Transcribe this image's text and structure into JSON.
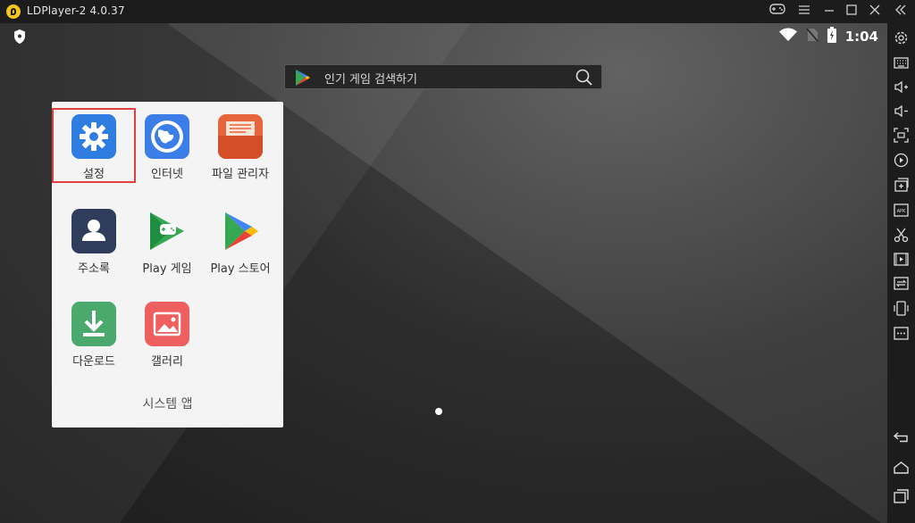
{
  "window": {
    "title": "LDPlayer-2 4.0.37"
  },
  "titlebar_buttons": [
    "gamepad-icon",
    "menu-icon",
    "minimize-icon",
    "maximize-icon",
    "close-icon",
    "collapse-icon"
  ],
  "status": {
    "time": "1:04"
  },
  "search": {
    "placeholder": "인기 게임 검색하기"
  },
  "folder": {
    "name": "시스템 앱",
    "apps": [
      {
        "label": "설정",
        "icon": "settings-icon",
        "selected": true
      },
      {
        "label": "인터넷",
        "icon": "browser-icon"
      },
      {
        "label": "파일 관리자",
        "icon": "file-manager-icon"
      },
      {
        "label": "주소록",
        "icon": "contacts-icon"
      },
      {
        "label": "Play 게임",
        "icon": "play-games-icon"
      },
      {
        "label": "Play 스토어",
        "icon": "play-store-icon"
      },
      {
        "label": "다운로드",
        "icon": "download-icon"
      },
      {
        "label": "갤러리",
        "icon": "gallery-icon"
      }
    ]
  },
  "sidebar": {
    "tools": [
      "settings-icon",
      "keyboard-icon",
      "volume-up-icon",
      "volume-down-icon",
      "screenshot-icon",
      "record-icon",
      "add-window-icon",
      "apk-icon",
      "scissors-icon",
      "video-icon",
      "sync-icon",
      "shake-icon",
      "more-icon"
    ],
    "nav": [
      "back-icon",
      "home-icon",
      "recents-icon"
    ]
  },
  "colors": {
    "highlight": "#e04040",
    "folder_bg": "#f4f4f4",
    "settings": "#2f7de1",
    "browser": "#3b7ee8",
    "files": "#e8643a",
    "contacts": "#2f3c5c",
    "download": "#4aa96c",
    "gallery": "#ee5f5f"
  }
}
